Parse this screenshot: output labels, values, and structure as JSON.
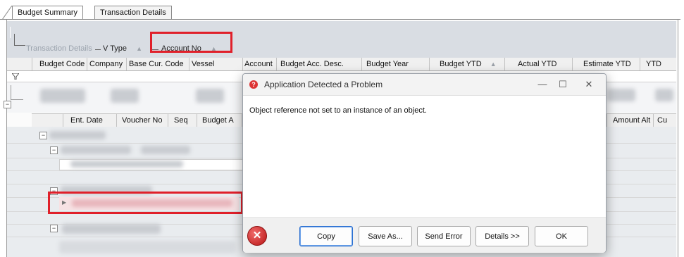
{
  "tabs": [
    {
      "label": "Budget Summary"
    },
    {
      "label": "Transaction Details"
    }
  ],
  "group_panel": {
    "chips": [
      {
        "label": "Transaction Details"
      },
      {
        "label": "V Type"
      },
      {
        "label": "Account No"
      }
    ],
    "sort_glyph": "▲"
  },
  "grid": {
    "columns": [
      {
        "label": "Budget Code"
      },
      {
        "label": "Company"
      },
      {
        "label": "Base Cur. Code"
      },
      {
        "label": "Vessel"
      },
      {
        "label": "Account"
      },
      {
        "label": "Budget Acc. Desc."
      },
      {
        "label": "Budget Year"
      },
      {
        "label": "Budget YTD"
      },
      {
        "label": "Actual YTD"
      },
      {
        "label": "Estimate YTD"
      },
      {
        "label": "YTD"
      }
    ],
    "filter_icon": "filter-icon",
    "sub_columns": [
      {
        "label": "Ent. Date"
      },
      {
        "label": "Voucher No"
      },
      {
        "label": "Seq"
      },
      {
        "label": "Budget A"
      },
      {
        "label": "Amount Alt"
      },
      {
        "label": "Cu"
      }
    ]
  },
  "dialog": {
    "title": "Application Detected a Problem",
    "message": "Object reference not set to an instance of an object.",
    "buttons": {
      "copy": "Copy",
      "save_as": "Save As...",
      "send_error": "Send Error",
      "details": "Details >>",
      "ok": "OK"
    },
    "window_controls": {
      "minimize": "—",
      "maximize": "☐",
      "close": "✕"
    },
    "error_icon": "error-icon"
  },
  "colors": {
    "highlight": "#e0202a",
    "group_band": "#d9dde3"
  }
}
